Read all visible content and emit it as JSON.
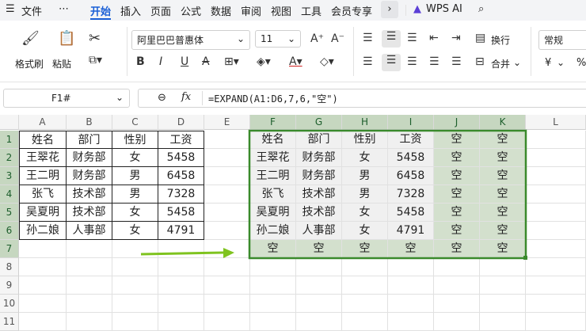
{
  "menubar": {
    "file_label": "文件",
    "more_label": "⋯",
    "tabs": [
      {
        "label": "开始",
        "active": true
      },
      {
        "label": "插入"
      },
      {
        "label": "页面"
      },
      {
        "label": "公式"
      },
      {
        "label": "数据"
      },
      {
        "label": "审阅"
      },
      {
        "label": "视图"
      },
      {
        "label": "工具"
      },
      {
        "label": "会员专享"
      }
    ],
    "wps_ai": "WPS AI"
  },
  "ribbon": {
    "format_painter": "格式刷",
    "paste": "粘贴",
    "font_name": "阿里巴巴普惠体",
    "font_size": "11",
    "wrap_text": "换行",
    "merge": "合并",
    "number_format": "常规",
    "currency": "¥",
    "percent": "%"
  },
  "formula_bar": {
    "name_box": "F1#",
    "formula": "=EXPAND(A1:D6,7,6,\"空\")"
  },
  "sheet": {
    "columns": [
      "A",
      "B",
      "C",
      "D",
      "E",
      "F",
      "G",
      "H",
      "I",
      "J",
      "K",
      "L"
    ],
    "rows": [
      "1",
      "2",
      "3",
      "4",
      "5",
      "6",
      "7",
      "8",
      "9",
      "10",
      "11"
    ],
    "source": [
      [
        "姓名",
        "部门",
        "性别",
        "工资"
      ],
      [
        "王翠花",
        "财务部",
        "女",
        "5458"
      ],
      [
        "王二明",
        "财务部",
        "男",
        "6458"
      ],
      [
        "张飞",
        "技术部",
        "男",
        "7328"
      ],
      [
        "吴夏明",
        "技术部",
        "女",
        "5458"
      ],
      [
        "孙二娘",
        "人事部",
        "女",
        "4791"
      ]
    ],
    "spill": [
      [
        "姓名",
        "部门",
        "性别",
        "工资",
        "空",
        "空"
      ],
      [
        "王翠花",
        "财务部",
        "女",
        "5458",
        "空",
        "空"
      ],
      [
        "王二明",
        "财务部",
        "男",
        "6458",
        "空",
        "空"
      ],
      [
        "张飞",
        "技术部",
        "男",
        "7328",
        "空",
        "空"
      ],
      [
        "吴夏明",
        "技术部",
        "女",
        "5458",
        "空",
        "空"
      ],
      [
        "孙二娘",
        "人事部",
        "女",
        "4791",
        "空",
        "空"
      ],
      [
        "空",
        "空",
        "空",
        "空",
        "空",
        "空"
      ]
    ]
  },
  "colors": {
    "accent": "#1a5fd6",
    "spill_border": "#3a8a2c",
    "arrow": "#7fc31f",
    "spill_fill": "#d3e0cd"
  }
}
